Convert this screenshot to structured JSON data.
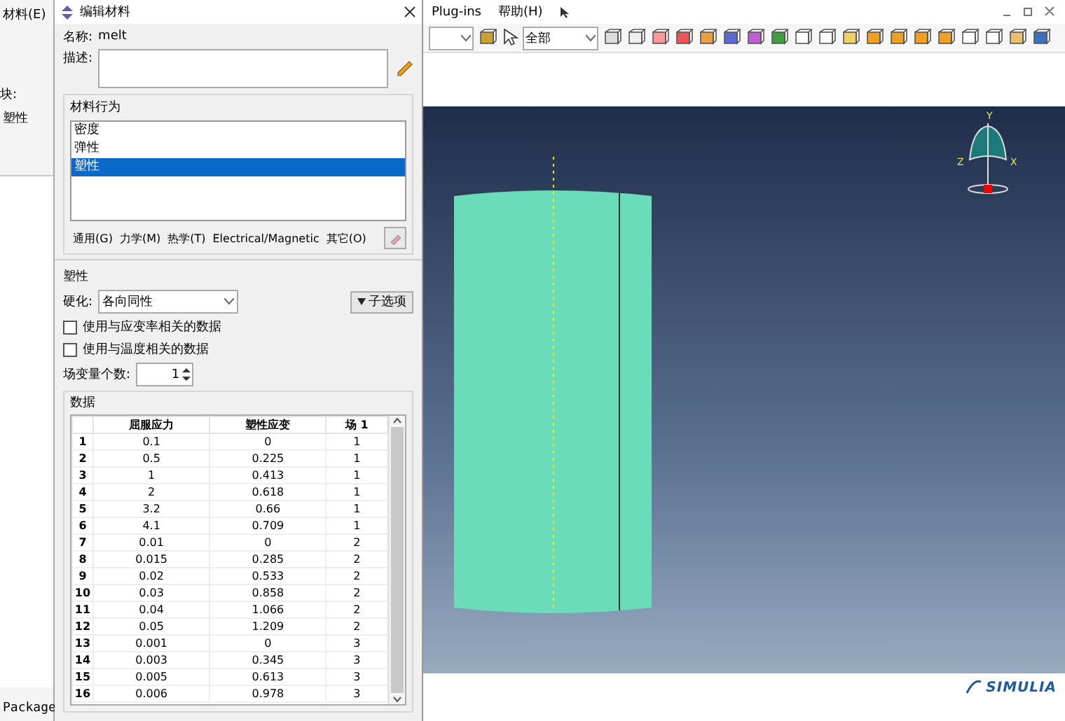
{
  "background_app": {
    "menu_item": "材料(E)",
    "block_label": "块:",
    "block_value": "塑性",
    "console_text": "Package"
  },
  "dialog": {
    "title": "编辑材料",
    "name_label": "名称:",
    "name_value": "melt",
    "description_label": "描述:",
    "behaviors_group": "材料行为",
    "behaviors": [
      {
        "label": "密度",
        "selected": false
      },
      {
        "label": "弹性",
        "selected": false
      },
      {
        "label": "塑性",
        "selected": true
      }
    ],
    "menus": [
      "通用(G)",
      "力学(M)",
      "热学(T)",
      "Electrical/Magnetic",
      "其它(O)"
    ],
    "section_title": "塑性",
    "hardening_label": "硬化:",
    "hardening_value": "各向同性",
    "suboptions_button": "子选项",
    "options": [
      {
        "label": "使用与应变率相关的数据",
        "checked": false
      },
      {
        "label": "使用与温度相关的数据",
        "checked": false
      }
    ],
    "field_count_label": "场变量个数:",
    "field_count_value": "1",
    "data_group": "数据",
    "table": {
      "columns": [
        "屈服应力",
        "塑性应变",
        "场 1"
      ],
      "rows": [
        {
          "index": "1",
          "cells": [
            "0.1",
            "0",
            "1"
          ]
        },
        {
          "index": "2",
          "cells": [
            "0.5",
            "0.225",
            "1"
          ]
        },
        {
          "index": "3",
          "cells": [
            "1",
            "0.413",
            "1"
          ]
        },
        {
          "index": "4",
          "cells": [
            "2",
            "0.618",
            "1"
          ]
        },
        {
          "index": "5",
          "cells": [
            "3.2",
            "0.66",
            "1"
          ]
        },
        {
          "index": "6",
          "cells": [
            "4.1",
            "0.709",
            "1"
          ]
        },
        {
          "index": "7",
          "cells": [
            "0.01",
            "0",
            "2"
          ]
        },
        {
          "index": "8",
          "cells": [
            "0.015",
            "0.285",
            "2"
          ]
        },
        {
          "index": "9",
          "cells": [
            "0.02",
            "0.533",
            "2"
          ]
        },
        {
          "index": "10",
          "cells": [
            "0.03",
            "0.858",
            "2"
          ]
        },
        {
          "index": "11",
          "cells": [
            "0.04",
            "1.066",
            "2"
          ]
        },
        {
          "index": "12",
          "cells": [
            "0.05",
            "1.209",
            "2"
          ]
        },
        {
          "index": "13",
          "cells": [
            "0.001",
            "0",
            "3"
          ]
        },
        {
          "index": "14",
          "cells": [
            "0.003",
            "0.345",
            "3"
          ]
        },
        {
          "index": "15",
          "cells": [
            "0.005",
            "0.613",
            "3"
          ]
        },
        {
          "index": "16",
          "cells": [
            "0.006",
            "0.978",
            "3"
          ]
        }
      ]
    }
  },
  "main_window": {
    "menus": [
      "Plug-ins",
      "帮助(H)"
    ],
    "selection_filter": "全部",
    "triad_labels": [
      "Y",
      "Z",
      "X"
    ],
    "brand": "SIMULIA"
  }
}
